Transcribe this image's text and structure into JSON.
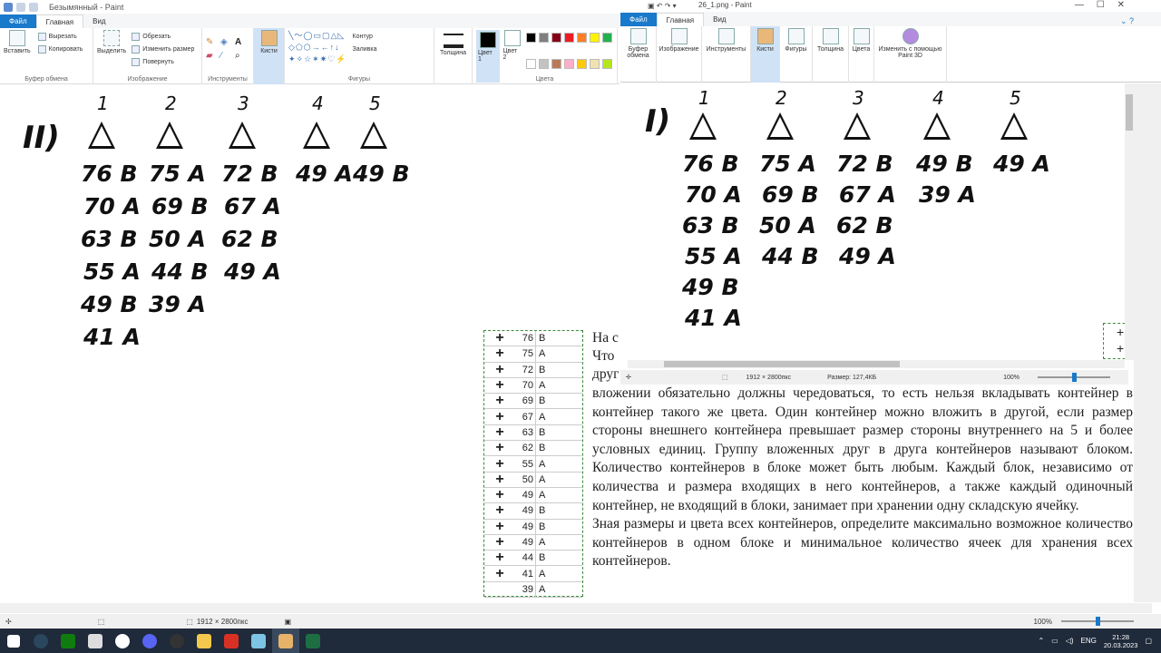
{
  "win1": {
    "title": "Безымянный - Paint",
    "tabs": [
      "Файл",
      "Главная",
      "Вид"
    ],
    "groups": {
      "clipboard": {
        "label": "Буфер обмена",
        "paste": "Вставить",
        "cut": "Вырезать",
        "copy": "Копировать"
      },
      "image": {
        "label": "Изображение",
        "select": "Выделить",
        "crop": "Обрезать",
        "resize": "Изменить размер",
        "rotate": "Повернуть"
      },
      "tools": {
        "label": "Инструменты"
      },
      "brushes": {
        "label": "Кисти"
      },
      "shapes": {
        "label": "Фигуры",
        "outline": "Контур",
        "fill": "Заливка"
      },
      "size": {
        "label": "Толщина"
      },
      "color1": "Цвет 1",
      "color2": "Цвет 2",
      "colors": {
        "label": "Цвета"
      }
    },
    "status": {
      "size": "1912 × 2800пкс",
      "zoom": "100%"
    }
  },
  "win2": {
    "title": "26_1.png - Paint",
    "tabs": [
      "Файл",
      "Главная",
      "Вид"
    ],
    "groups": [
      "Буфер обмена",
      "Изображение",
      "Инструменты",
      "Кисти",
      "Фигуры",
      "Толщина",
      "Цвета",
      "Изменить с помощью Paint 3D"
    ],
    "status": {
      "size": "1912 × 2800пкс",
      "filesize": "Размер: 127,4КБ",
      "zoom": "100%"
    }
  },
  "left_drawing": {
    "roman": "II)",
    "columns": [
      {
        "n": "1",
        "items": [
          "76 B",
          "70 A",
          "63 B",
          "55 A",
          "49 B",
          "41 A"
        ]
      },
      {
        "n": "2",
        "items": [
          "75 A",
          "69 B",
          "50 A",
          "44 B",
          "39 A"
        ]
      },
      {
        "n": "3",
        "items": [
          "72 B",
          "67 A",
          "62 B",
          "49 A"
        ]
      },
      {
        "n": "4",
        "items": [
          "49 A"
        ]
      },
      {
        "n": "5",
        "items": [
          "49 B"
        ]
      }
    ]
  },
  "right_drawing": {
    "roman": "I)",
    "columns": [
      {
        "n": "1",
        "items": [
          "76 B",
          "70 A",
          "63 B",
          "55 A",
          "49 B",
          "41 A"
        ]
      },
      {
        "n": "2",
        "items": [
          "75 A",
          "69 B",
          "50 A",
          "44 B"
        ]
      },
      {
        "n": "3",
        "items": [
          "72 B",
          "67 A",
          "62 B",
          "49 A"
        ]
      },
      {
        "n": "4",
        "items": [
          "49 B",
          "39 A"
        ]
      },
      {
        "n": "5",
        "items": [
          "49 A"
        ]
      }
    ]
  },
  "table": [
    [
      "+",
      "76",
      "B"
    ],
    [
      "+",
      "75",
      "A"
    ],
    [
      "+",
      "72",
      "B"
    ],
    [
      "+",
      "70",
      "A"
    ],
    [
      "+",
      "69",
      "B"
    ],
    [
      "+",
      "67",
      "A"
    ],
    [
      "+",
      "63",
      "B"
    ],
    [
      "+",
      "62",
      "B"
    ],
    [
      "+",
      "55",
      "A"
    ],
    [
      "+",
      "50",
      "A"
    ],
    [
      "+",
      "49",
      "A"
    ],
    [
      "+",
      "49",
      "B"
    ],
    [
      "+",
      "49",
      "B"
    ],
    [
      "+",
      "49",
      "A"
    ],
    [
      "+",
      "44",
      "B"
    ],
    [
      "+",
      "41",
      "A"
    ],
    [
      "",
      "39",
      "A"
    ]
  ],
  "text": {
    "snip1": "На с",
    "snip2": "Что",
    "snip3": "друг",
    "para": "вложении обязательно должны чередоваться, то есть нельзя вкладывать контейнер в контейнер такого же цвета. Один контейнер можно вложить в другой, если размер стороны внешнего контейнера превышает размер стороны внутреннего на 5 и более условных единиц. Группу вложенных друг в друга контейнеров называют блоком. Количество контейнеров в блоке может быть любым. Каждый блок, независимо от количества и размера входящих в него контейнеров, а также каждый одиночный контейнер, не входящий в блоки, занимает при хранении одну складскую ячейку.",
    "para2": "Зная размеры и цвета всех контейнеров, определите максимально возможное количество контейнеров в одном блоке и минимальное количество ячеек для хранения всех контейнеров."
  },
  "taskbar": {
    "lang": "ENG",
    "time": "21:28",
    "date": "20.03.2023"
  },
  "colors": {
    "accent": "#1979ca",
    "taskbar": "#1f2a3a"
  }
}
